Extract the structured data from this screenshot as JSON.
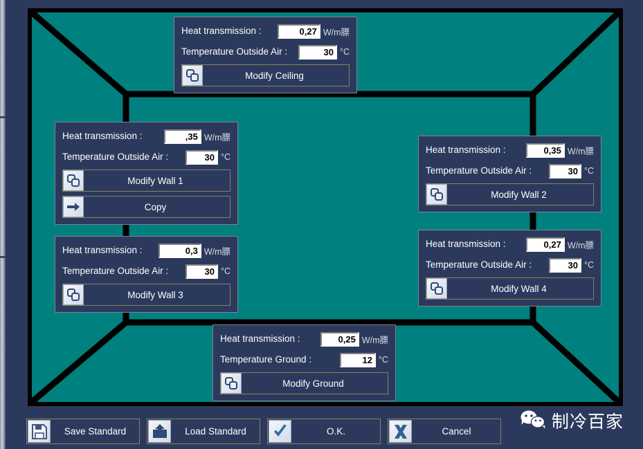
{
  "theme": {
    "background": "#2b3a5c",
    "room_fill": "#00807f",
    "room_outline": "#000000",
    "panel_bg": "#2b3a5c",
    "panel_border": "#7d8294",
    "button_border": "#8a7f62",
    "field_bg": "#ffffff",
    "text": "#ffffff"
  },
  "labels": {
    "heat_transmission": "Heat transmission :",
    "temperature_outside_air": "Temperature Outside Air :",
    "temperature_ground": "Temperature Ground :",
    "unit_u_value": "W/m膘",
    "unit_celsius": "°C"
  },
  "panels": {
    "ceiling": {
      "heat_transmission": "0,27",
      "temperature_label": "Temperature Outside Air :",
      "temperature": "30",
      "button_label": "Modify Ceiling",
      "button_icon": "copy-shapes-icon"
    },
    "wall1": {
      "heat_transmission": ",35",
      "temperature_label": "Temperature Outside Air :",
      "temperature": "30",
      "button_label": "Modify Wall 1",
      "button_icon": "copy-shapes-icon",
      "copy_label": "Copy",
      "copy_icon": "arrow-right-icon"
    },
    "wall2": {
      "heat_transmission": "0,35",
      "temperature_label": "Temperature Outside Air :",
      "temperature": "30",
      "button_label": "Modify Wall 2",
      "button_icon": "copy-shapes-icon"
    },
    "wall3": {
      "heat_transmission": "0,3",
      "temperature_label": "Temperature Outside Air :",
      "temperature": "30",
      "button_label": "Modify Wall 3",
      "button_icon": "copy-shapes-icon"
    },
    "wall4": {
      "heat_transmission": "0,27",
      "temperature_label": "Temperature Outside Air :",
      "temperature": "30",
      "button_label": "Modify Wall 4",
      "button_icon": "copy-shapes-icon"
    },
    "ground": {
      "heat_transmission": "0,25",
      "temperature_label": "Temperature Ground :",
      "temperature": "12",
      "button_label": "Modify Ground",
      "button_icon": "copy-shapes-icon"
    }
  },
  "toolbar": {
    "save_label": "Save Standard",
    "save_icon": "floppy-disk-icon",
    "load_label": "Load Standard",
    "load_icon": "upload-folder-icon",
    "ok_label": "O.K.",
    "ok_icon": "checkmark-icon",
    "cancel_label": "Cancel",
    "cancel_icon": "x-mark-icon"
  },
  "watermark": {
    "text": "制冷百家",
    "icon": "wechat-icon"
  }
}
